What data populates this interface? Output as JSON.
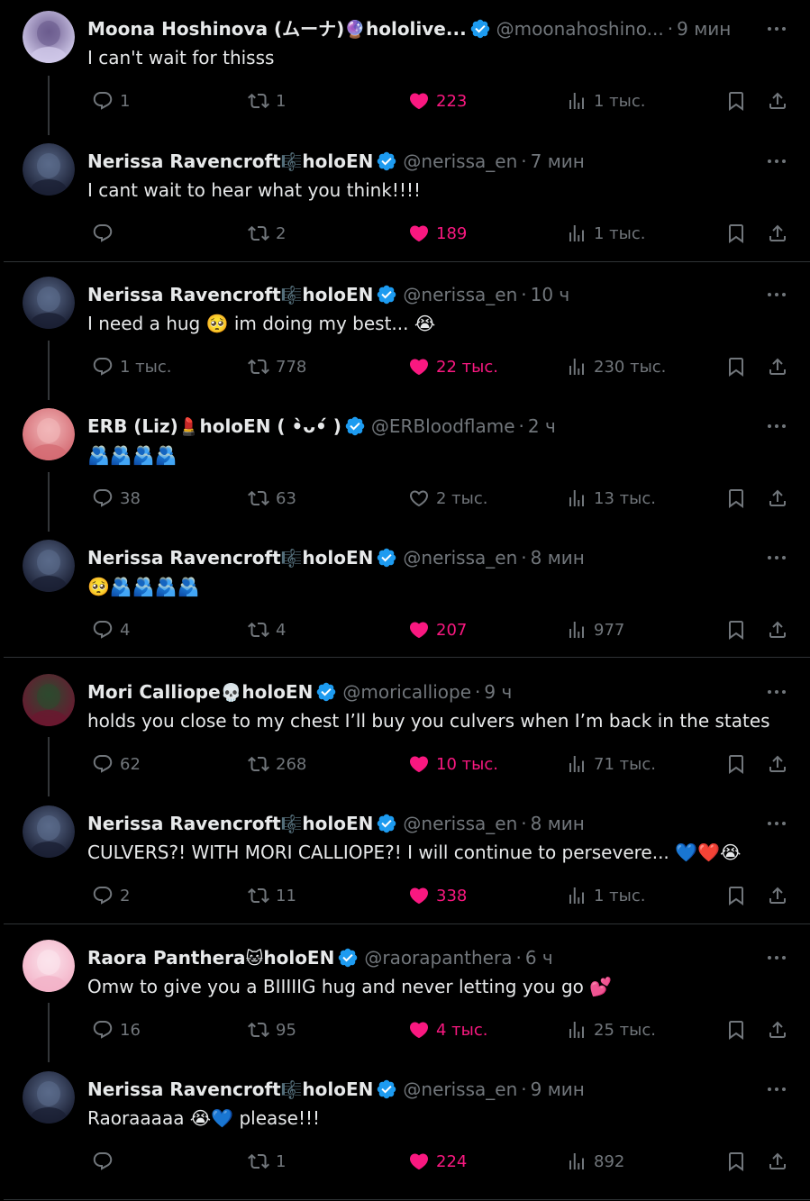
{
  "tweets": [
    {
      "name": "Moona Hoshinova (ムーナ)",
      "name_emoji": "🔮",
      "name_suffix": "hololive...",
      "handle": "@moonahoshino...",
      "time": "9 мин",
      "text": "I can't wait for thisss",
      "replies": "1",
      "reposts": "1",
      "likes": "223",
      "views": "1 тыс.",
      "liked": true,
      "avatar": "moona"
    },
    {
      "name": "Nerissa Ravencroft",
      "name_emoji": "🎼",
      "name_suffix": "holoEN",
      "handle": "@nerissa_en",
      "time": "7 мин",
      "text": "I cant wait to hear what you think!!!!",
      "replies": "",
      "reposts": "2",
      "likes": "189",
      "views": "1 тыс.",
      "liked": true,
      "avatar": "nerissa"
    },
    {
      "name": "Nerissa Ravencroft",
      "name_emoji": "🎼",
      "name_suffix": "holoEN",
      "handle": "@nerissa_en",
      "time": "10 ч",
      "text": "I need a hug 🥺 im doing my best... 😭",
      "replies": "1 тыс.",
      "reposts": "778",
      "likes": "22 тыс.",
      "views": "230 тыс.",
      "liked": true,
      "avatar": "nerissa"
    },
    {
      "name": "ERB (Liz)",
      "name_emoji": "💄",
      "name_suffix": "holoEN ( •̀ᴗ•́ )",
      "handle": "@ERBloodflame",
      "time": "2 ч",
      "text": "🫂🫂🫂🫂",
      "replies": "38",
      "reposts": "63",
      "likes": "2 тыс.",
      "views": "13 тыс.",
      "liked": false,
      "avatar": "erb"
    },
    {
      "name": "Nerissa Ravencroft",
      "name_emoji": "🎼",
      "name_suffix": "holoEN",
      "handle": "@nerissa_en",
      "time": "8 мин",
      "text": "🥺🫂🫂🫂🫂",
      "replies": "4",
      "reposts": "4",
      "likes": "207",
      "views": "977",
      "liked": true,
      "avatar": "nerissa"
    },
    {
      "name": "Mori Calliope",
      "name_emoji": "💀",
      "name_suffix": "holoEN",
      "handle": "@moricalliope",
      "time": "9 ч",
      "text": "holds you close to my chest I’ll buy you culvers when I’m back in the states",
      "replies": "62",
      "reposts": "268",
      "likes": "10 тыс.",
      "views": "71 тыс.",
      "liked": true,
      "avatar": "mori"
    },
    {
      "name": "Nerissa Ravencroft",
      "name_emoji": "🎼",
      "name_suffix": "holoEN",
      "handle": "@nerissa_en",
      "time": "8 мин",
      "text": "CULVERS?! WITH MORI CALLIOPE?! I will continue to persevere... 💙❤️😭",
      "replies": "2",
      "reposts": "11",
      "likes": "338",
      "views": "1 тыс.",
      "liked": true,
      "avatar": "nerissa"
    },
    {
      "name": "Raora Panthera",
      "name_emoji": "🐱",
      "name_suffix": "holoEN",
      "handle": "@raorapanthera",
      "time": "6 ч",
      "text": "Omw to give you a BIIIIIG hug and never letting you go 💕",
      "replies": "16",
      "reposts": "95",
      "likes": "4 тыс.",
      "views": "25 тыс.",
      "liked": true,
      "avatar": "raora"
    },
    {
      "name": "Nerissa Ravencroft",
      "name_emoji": "🎼",
      "name_suffix": "holoEN",
      "handle": "@nerissa_en",
      "time": "9 мин",
      "text": "Raoraaaaa 😭💙 please!!!",
      "replies": "",
      "reposts": "1",
      "likes": "224",
      "views": "892",
      "liked": true,
      "avatar": "nerissa"
    }
  ],
  "colors": {
    "background": "#000000",
    "text": "#e7e9ea",
    "muted": "#71767b",
    "like": "#f91880",
    "verified": "#1d9bf0",
    "divider": "#2f3336"
  },
  "icons": [
    "reply-icon",
    "repost-icon",
    "heart-icon",
    "views-icon",
    "bookmark-icon",
    "share-icon",
    "more-icon",
    "verified-icon"
  ]
}
